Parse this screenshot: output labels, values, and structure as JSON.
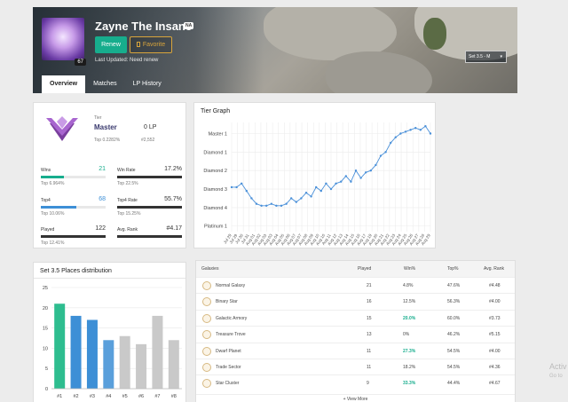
{
  "profile": {
    "summoner_name": "Zayne The Insane",
    "region": "NA",
    "level": "67",
    "renew_label": "Renew",
    "favorite_label": "Favorite",
    "last_updated": "Last Updated: Need renew",
    "set_select": "Set 3.5 - M"
  },
  "tabs": [
    {
      "label": "Overview",
      "active": true
    },
    {
      "label": "Matches",
      "active": false
    },
    {
      "label": "LP History",
      "active": false
    }
  ],
  "summary": {
    "tier_label": "Tier",
    "tier_name": "Master",
    "lp": "0 LP",
    "top_percent": "Top 0.2282%",
    "rank": "#2,552",
    "stats": [
      {
        "label": "Wins",
        "value": "21",
        "sub": "Top 6.964%",
        "fill": 0.35,
        "color": "#17ad8d",
        "value_color": "#17ad8d"
      },
      {
        "label": "Win Rate",
        "value": "17.2%",
        "sub": "Top 22.5%",
        "fill": 1.0,
        "color": "#333333",
        "value_color": "#333333"
      },
      {
        "label": "Top4",
        "value": "68",
        "sub": "Top 10.06%",
        "fill": 0.55,
        "color": "#3d8fd6",
        "value_color": "#3d8fd6"
      },
      {
        "label": "Top4 Rate",
        "value": "55.7%",
        "sub": "Top 15.25%",
        "fill": 1.0,
        "color": "#333333",
        "value_color": "#333333"
      },
      {
        "label": "Played",
        "value": "122",
        "sub": "Top 12.41%",
        "fill": 1.0,
        "color": "#333333",
        "value_color": "#333333"
      },
      {
        "label": "Avg. Rank",
        "value": "#4.17",
        "sub": "",
        "fill": 1.0,
        "color": "#333333",
        "value_color": "#333333"
      }
    ]
  },
  "tier_graph": {
    "title": "Tier Graph"
  },
  "chart_data": [
    {
      "type": "line",
      "title": "Tier Graph",
      "y_tick_labels": [
        "Platinum 1",
        "Diamond 4",
        "Diamond 3",
        "Diamond 2",
        "Diamond 1",
        "Master 1"
      ],
      "y_tick_values": [
        0,
        1,
        2,
        3,
        4,
        5
      ],
      "ylim": [
        -0.3,
        5.6
      ],
      "x": [
        "Jul 28",
        "Jul 29",
        "Jul 29",
        "Jul 30",
        "Jul 30",
        "Jul 31",
        "Jul 31",
        "Aug 01",
        "Aug 01",
        "Aug 02",
        "Aug 02",
        "Aug 03",
        "Aug 03",
        "Aug 04",
        "Aug 04",
        "Aug 05",
        "Aug 05",
        "Aug 06",
        "Aug 06",
        "Aug 07",
        "Aug 07",
        "Aug 08",
        "Aug 08",
        "Aug 09",
        "Aug 09",
        "Aug 10",
        "Aug 10",
        "Aug 11",
        "Aug 11",
        "Aug 12",
        "Aug 12",
        "Aug 13",
        "Aug 13",
        "Aug 14",
        "Aug 14",
        "Aug 15",
        "Aug 15",
        "Aug 16",
        "Aug 16",
        "Aug 17",
        "Aug 17"
      ],
      "x_tick_labels": [
        "Jul 29",
        "Jul 29",
        "Jul 30",
        "Jul 31",
        "Aug 01",
        "Aug 02",
        "Aug 03",
        "Aug 03",
        "Aug 04",
        "Aug 05",
        "Aug 06",
        "Aug 07",
        "Aug 07",
        "Aug 08",
        "Aug 09",
        "Aug 10",
        "Aug 10",
        "Aug 11",
        "Aug 12",
        "Aug 13",
        "Aug 14",
        "Aug 15",
        "Aug 16",
        "Aug 17",
        "Aug 19",
        "Aug 20",
        "Aug 21",
        "Aug 22",
        "Aug 23",
        "Aug 24",
        "Aug 25",
        "Aug 26",
        "Aug 27",
        "Aug 28",
        "Aug 29"
      ],
      "values": [
        2.1,
        2.1,
        2.3,
        1.9,
        1.5,
        1.2,
        1.1,
        1.1,
        1.2,
        1.1,
        1.1,
        1.2,
        1.5,
        1.3,
        1.5,
        1.8,
        1.6,
        2.1,
        1.9,
        2.3,
        2.0,
        2.3,
        2.4,
        2.7,
        2.4,
        3.0,
        2.6,
        2.9,
        3.0,
        3.3,
        3.8,
        4.0,
        4.5,
        4.8,
        5.0,
        5.1,
        5.2,
        5.3,
        5.2,
        5.4,
        5.0
      ]
    },
    {
      "type": "bar",
      "title": "Set 3.5 Places distribution",
      "categories": [
        "#1",
        "#2",
        "#3",
        "#4",
        "#5",
        "#6",
        "#7",
        "#8"
      ],
      "values": [
        21,
        18,
        17,
        12,
        13,
        11,
        18,
        12
      ],
      "colors": [
        "#2ebd8f",
        "#3d8fd6",
        "#3d8fd6",
        "#5a9fdb",
        "#c9c9c9",
        "#c9c9c9",
        "#c9c9c9",
        "#c9c9c9"
      ],
      "ylim": [
        0,
        25
      ],
      "y_ticks": [
        0,
        5,
        10,
        15,
        20,
        25
      ],
      "grid": true
    }
  ],
  "galaxies": {
    "headers": [
      "Galaxies",
      "Played",
      "Win%",
      "Top%",
      "Avg. Rank"
    ],
    "rows": [
      {
        "name": "Normal Galaxy",
        "played": "21",
        "win": "4.8%",
        "top": "47.6%",
        "avg": "#4.48",
        "win_green": false
      },
      {
        "name": "Binary Star",
        "played": "16",
        "win": "12.5%",
        "top": "56.3%",
        "avg": "#4.00",
        "win_green": false
      },
      {
        "name": "Galactic Armory",
        "played": "15",
        "win": "20.0%",
        "top": "60.0%",
        "avg": "#3.73",
        "win_green": true
      },
      {
        "name": "Treasure Trove",
        "played": "13",
        "win": "0%",
        "top": "46.2%",
        "avg": "#5.15",
        "win_green": false
      },
      {
        "name": "Dwarf Planet",
        "played": "11",
        "win": "27.3%",
        "top": "54.5%",
        "avg": "#4.00",
        "win_green": true
      },
      {
        "name": "Trade Sector",
        "played": "11",
        "win": "18.2%",
        "top": "54.5%",
        "avg": "#4.36",
        "win_green": false
      },
      {
        "name": "Star Cluster",
        "played": "9",
        "win": "33.3%",
        "top": "44.4%",
        "avg": "#4.67",
        "win_green": true
      }
    ],
    "view_more": "+ View More"
  },
  "watermark": {
    "line1": "Activ",
    "line2": "Go to"
  }
}
